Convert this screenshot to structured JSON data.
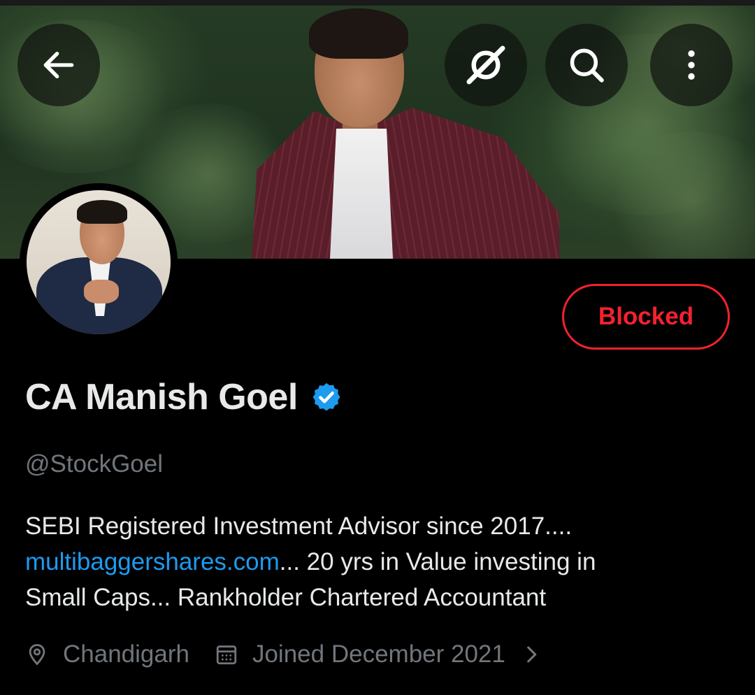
{
  "header": {
    "back_icon": "arrow-left-icon",
    "grok_icon": "grok-icon",
    "search_icon": "search-icon",
    "more_icon": "more-vertical-icon"
  },
  "profile": {
    "display_name": "CA Manish Goel",
    "verified": true,
    "handle": "@StockGoel",
    "action_button": "Blocked",
    "bio_line1": "SEBI Registered Investment Advisor since 2017....",
    "bio_link": "multibaggershares.com",
    "bio_line2_rest": "... 20 yrs in Value investing in",
    "bio_line3": "Small Caps... Rankholder Chartered Accountant",
    "location": "Chandigarh",
    "joined": "Joined December 2021"
  },
  "colors": {
    "background": "#000000",
    "primary_text": "#e7e9ea",
    "secondary_text": "#71767b",
    "link": "#1d9bf0",
    "blocked": "#f4212e",
    "verified_badge": "#1d9bf0"
  }
}
